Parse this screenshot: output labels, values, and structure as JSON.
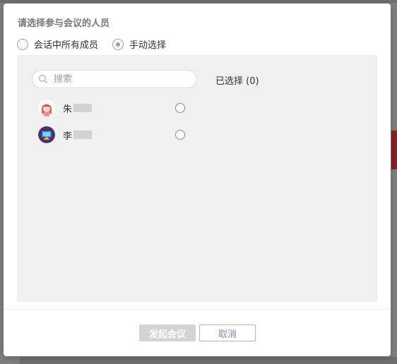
{
  "dialog": {
    "title": "请选择参与会议的人员",
    "mode_options": [
      {
        "label": "会话中所有成员",
        "checked": false
      },
      {
        "label": "手动选择",
        "checked": true
      }
    ],
    "search": {
      "placeholder": "搜索",
      "value": ""
    },
    "selected_label": "已选择 (0)",
    "members": [
      {
        "name": "朱",
        "avatar_icon": "avatar-red-hair-girl-icon",
        "selected": false
      },
      {
        "name": "李",
        "avatar_icon": "avatar-monitor-icon",
        "selected": false
      }
    ],
    "buttons": {
      "start": "发起会议",
      "cancel": "取消"
    }
  },
  "colors": {
    "accent": "#9d98c2",
    "panel_bg": "#f0f0f0",
    "disabled_button": "#d4d4d4",
    "cancel_text": "#8a82b8"
  }
}
